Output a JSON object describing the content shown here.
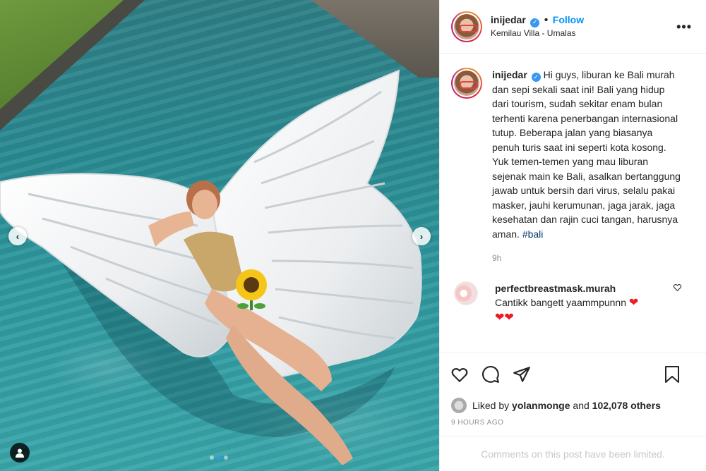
{
  "post": {
    "username": "inijedar",
    "verified_badge": "✓",
    "separator": "•",
    "follow_label": "Follow",
    "location": "Kemilau Villa - Umalas",
    "more_label": "•••"
  },
  "caption": {
    "username": "inijedar",
    "text": "Hi guys, liburan ke Bali murah dan sepi sekali saat ini! Bali yang hidup dari tourism, sudah sekitar enam bulan terhenti karena penerbangan internasional tutup. Beberapa jalan yang biasanya penuh turis saat ini seperti kota kosong. Yuk temen-temen yang mau liburan sejenak main ke Bali, asalkan bertanggung jawab untuk bersih dari virus, selalu pakai masker, jauhi kerumunan, jaga jarak, jaga kesehatan dan rajin cuci tangan, harusnya aman.",
    "hashtag": "#bali",
    "time": "9h"
  },
  "comment": {
    "username": "perfectbreastmask.murah",
    "text": "Cantikk bangett yaammpunnn",
    "emoji_line1": "❤",
    "emoji_line2": "❤❤"
  },
  "likes": {
    "prefix": "Liked by",
    "user": "yolanmonge",
    "and": "and",
    "count": "102,078 others"
  },
  "timestamp": "9 HOURS AGO",
  "comments_limited": "Comments on this post have been limited.",
  "carousel": {
    "prev": "‹",
    "next": "›",
    "slides": 3,
    "active_slide": 2
  },
  "colors": {
    "accent": "#0095f6",
    "verified": "#3897f0",
    "heart": "#ed1c24",
    "muted": "#8e8e8e"
  },
  "icons": [
    "heart-icon",
    "comment-icon",
    "share-icon",
    "bookmark-icon",
    "ellipsis-icon",
    "user-tag-icon",
    "chevron-left-icon",
    "chevron-right-icon"
  ]
}
